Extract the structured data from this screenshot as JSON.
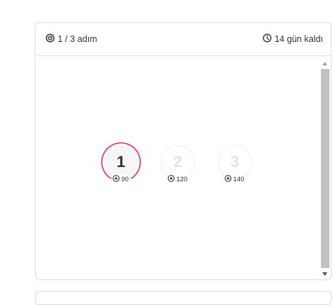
{
  "header": {
    "progress_text": "1 / 3 adım",
    "progress_icon": "target-icon",
    "time_text": "14 gün kaldı",
    "time_icon": "clock-icon"
  },
  "steps": [
    {
      "number": "1",
      "points": "90",
      "state": "active",
      "points_icon": "star-badge-icon"
    },
    {
      "number": "2",
      "points": "120",
      "state": "locked",
      "points_icon": "star-badge-icon"
    },
    {
      "number": "3",
      "points": "140",
      "state": "locked",
      "points_icon": "star-badge-icon"
    }
  ],
  "colors": {
    "accent": "#e0306e",
    "ring_light": "#f2a4bf",
    "locked_text": "#e2e2e2",
    "scroll_thumb": "#c1c1c1"
  }
}
